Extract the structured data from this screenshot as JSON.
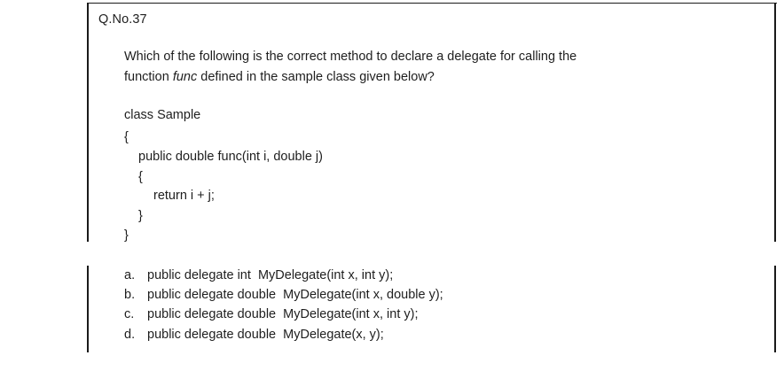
{
  "question": {
    "number": "Q.No.37",
    "line1": "Which of the following is the correct method to declare a delegate for calling the",
    "line2_before": "function ",
    "line2_italic": "func",
    "line2_after": " defined in the sample class given below?"
  },
  "code": [
    "class Sample",
    "{",
    "public double func(int i, double j)",
    "{",
    "return i + j;",
    "}",
    "}"
  ],
  "options": [
    {
      "letter": "a.",
      "text": "public delegate int  MyDelegate(int x, int y);"
    },
    {
      "letter": "b.",
      "text": "public delegate double  MyDelegate(int x, double y);"
    },
    {
      "letter": "c.",
      "text": "public delegate double  MyDelegate(int x, int y);"
    },
    {
      "letter": "d.",
      "text": "public delegate double  MyDelegate(x, y);"
    }
  ]
}
